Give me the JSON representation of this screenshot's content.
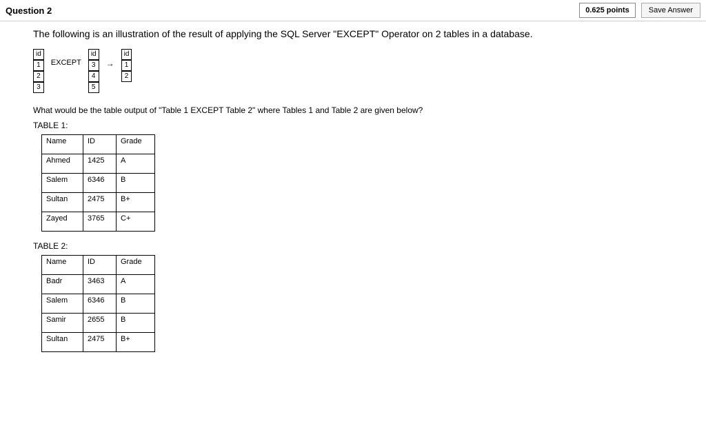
{
  "header": {
    "title": "Question 2",
    "points": "0.625 points",
    "saveLabel": "Save Answer"
  },
  "intro": "The following is an illustration of the result of applying the SQL Server \"EXCEPT\" Operator on 2 tables in a database.",
  "illustration": {
    "header": "id",
    "tableA": [
      "1",
      "2",
      "3"
    ],
    "operator": "EXCEPT",
    "tableB": [
      "3",
      "4",
      "5"
    ],
    "arrow": "→",
    "tableResult": [
      "1",
      "2"
    ]
  },
  "prompt": "What would be the table output of \"Table 1 EXCEPT Table 2\" where Tables 1 and Table 2 are given below?",
  "table1": {
    "label": "TABLE 1:",
    "headers": [
      "Name",
      "ID",
      "Grade"
    ],
    "rows": [
      {
        "name": "Ahmed",
        "id": "1425",
        "grade": "A"
      },
      {
        "name": "Salem",
        "id": "6346",
        "grade": "B"
      },
      {
        "name": "Sultan",
        "id": "2475",
        "grade": "B+"
      },
      {
        "name": "Zayed",
        "id": "3765",
        "grade": "C+"
      }
    ]
  },
  "table2": {
    "label": "TABLE 2:",
    "headers": [
      "Name",
      "ID",
      "Grade"
    ],
    "rows": [
      {
        "name": "Badr",
        "id": "3463",
        "grade": "A"
      },
      {
        "name": "Salem",
        "id": "6346",
        "grade": "B"
      },
      {
        "name": "Samir",
        "id": "2655",
        "grade": "B"
      },
      {
        "name": "Sultan",
        "id": "2475",
        "grade": "B+"
      }
    ]
  }
}
